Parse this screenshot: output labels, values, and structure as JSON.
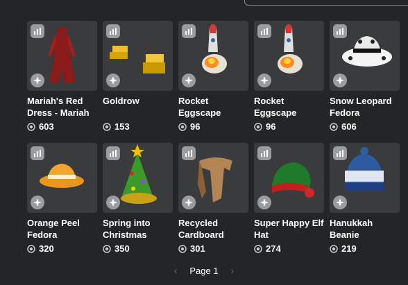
{
  "items": [
    {
      "name": "Mariah's Red Dress - Mariah",
      "price": "603",
      "art": "dress"
    },
    {
      "name": "Goldrow",
      "price": "153",
      "art": "gold"
    },
    {
      "name": "Rocket Eggscape",
      "price": "96",
      "art": "rocket"
    },
    {
      "name": "Rocket Eggscape",
      "price": "96",
      "art": "rocket"
    },
    {
      "name": "Snow Leopard Fedora",
      "price": "606",
      "art": "leopard"
    },
    {
      "name": "Orange Peel Fedora",
      "price": "320",
      "art": "orange"
    },
    {
      "name": "Spring into Christmas",
      "price": "350",
      "art": "tree"
    },
    {
      "name": "Recycled Cardboard",
      "price": "301",
      "art": "cardboard"
    },
    {
      "name": "Super Happy Elf Hat",
      "price": "274",
      "art": "elf"
    },
    {
      "name": "Hanukkah Beanie",
      "price": "219",
      "art": "beanie"
    }
  ],
  "pagination": {
    "label": "Page 1",
    "prev_icon": "chevron-left-icon",
    "next_icon": "chevron-right-icon"
  },
  "icons": {
    "stats": "bar-chart-icon",
    "try_on": "sparkle-icon",
    "currency": "robux-icon"
  },
  "colors": {
    "background": "#232527",
    "card": "#393b3d",
    "badge": "#9a9c9e"
  }
}
